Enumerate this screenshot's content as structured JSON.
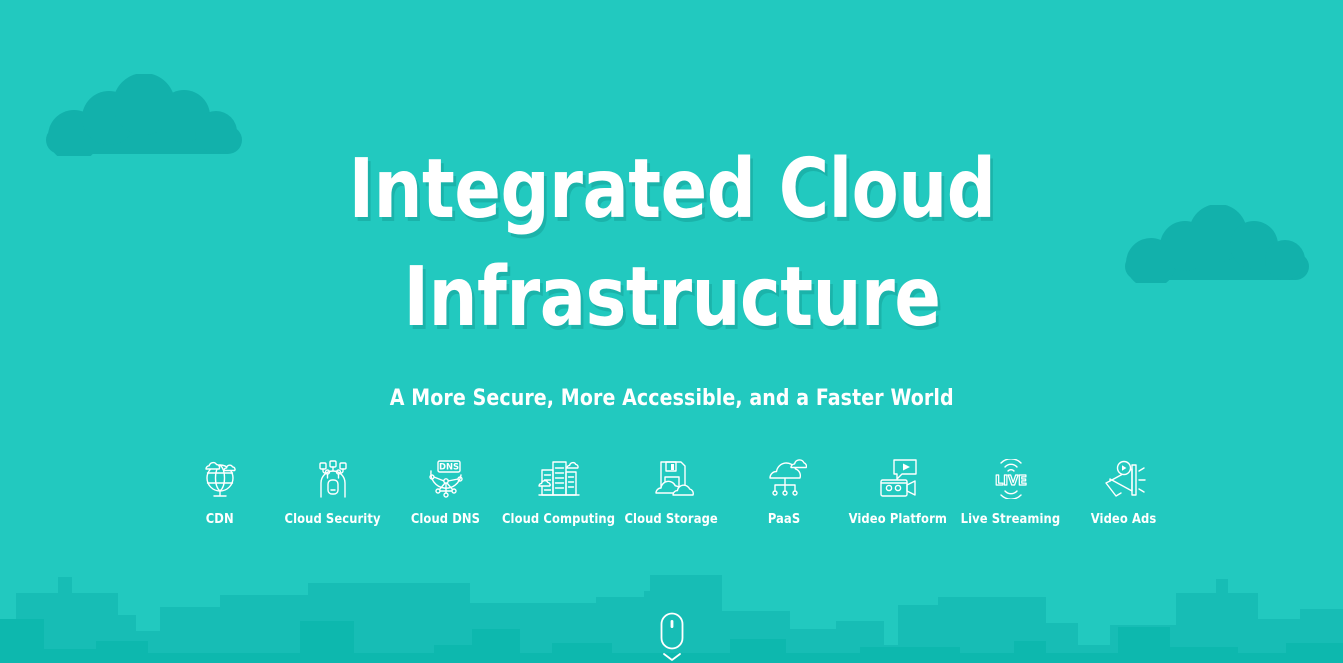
{
  "page": {
    "background_color": "#22c9bf",
    "cloud_color": "#12b1ab",
    "skyline_back_color": "#17bdb5",
    "skyline_front_color": "#0db8ae",
    "text_color": "#ffffff"
  },
  "hero": {
    "headline_line1": "Integrated Cloud",
    "headline_line2": "Infrastructure",
    "subtitle": "A More Secure, More Accessible, and a Faster World"
  },
  "services": [
    {
      "label": "CDN",
      "icon": "globe-cloud-icon"
    },
    {
      "label": "Cloud Security",
      "icon": "shield-network-icon"
    },
    {
      "label": "Cloud DNS",
      "icon": "dns-network-icon"
    },
    {
      "label": "Cloud Computing",
      "icon": "server-racks-icon"
    },
    {
      "label": "Cloud Storage",
      "icon": "floppy-cloud-icon"
    },
    {
      "label": "PaaS",
      "icon": "cloud-nodes-icon"
    },
    {
      "label": "Video Platform",
      "icon": "video-camera-play-icon"
    },
    {
      "label": "Live Streaming",
      "icon": "live-broadcast-icon"
    },
    {
      "label": "Video Ads",
      "icon": "megaphone-play-icon"
    }
  ],
  "decor": {
    "cloud_left": "cloud-shape",
    "cloud_right": "cloud-shape",
    "skyline": "city-skyline-silhouette"
  },
  "scroll": {
    "indicator": "scroll-mouse-icon",
    "chevron": "chevron-down-icon"
  }
}
